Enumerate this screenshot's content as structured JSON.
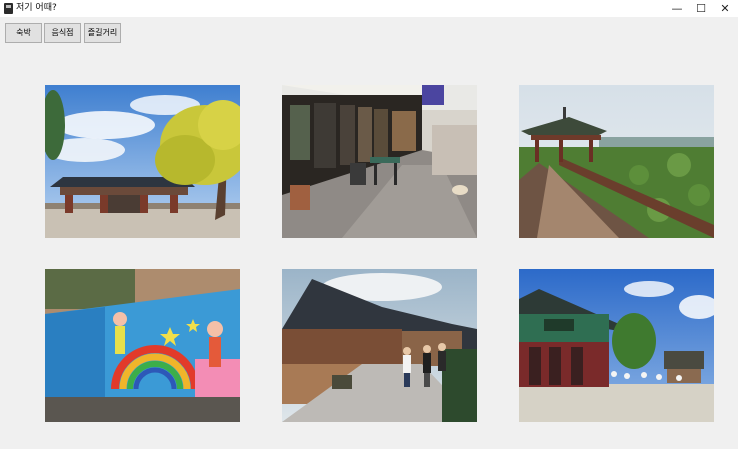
{
  "window": {
    "title": "저기 어때?",
    "minimize_glyph": "—",
    "maximize_glyph": "☐",
    "close_glyph": "✕"
  },
  "toolbar": {
    "buttons": [
      {
        "label": "숙박"
      },
      {
        "label": "음식점"
      },
      {
        "label": "즐길거리"
      }
    ]
  },
  "gallery": {
    "photos": [
      {
        "subject": "hanok-gate-ginkgo-tree"
      },
      {
        "subject": "cafe-street-alley"
      },
      {
        "subject": "pavilion-lotus-pond"
      },
      {
        "subject": "mural-wall-village"
      },
      {
        "subject": "hanok-village-street"
      },
      {
        "subject": "traditional-shrine-courtyard"
      }
    ]
  },
  "colors": {
    "background": "#f0f0f0",
    "button_face": "#e1e1e1",
    "button_border": "#adadad"
  }
}
